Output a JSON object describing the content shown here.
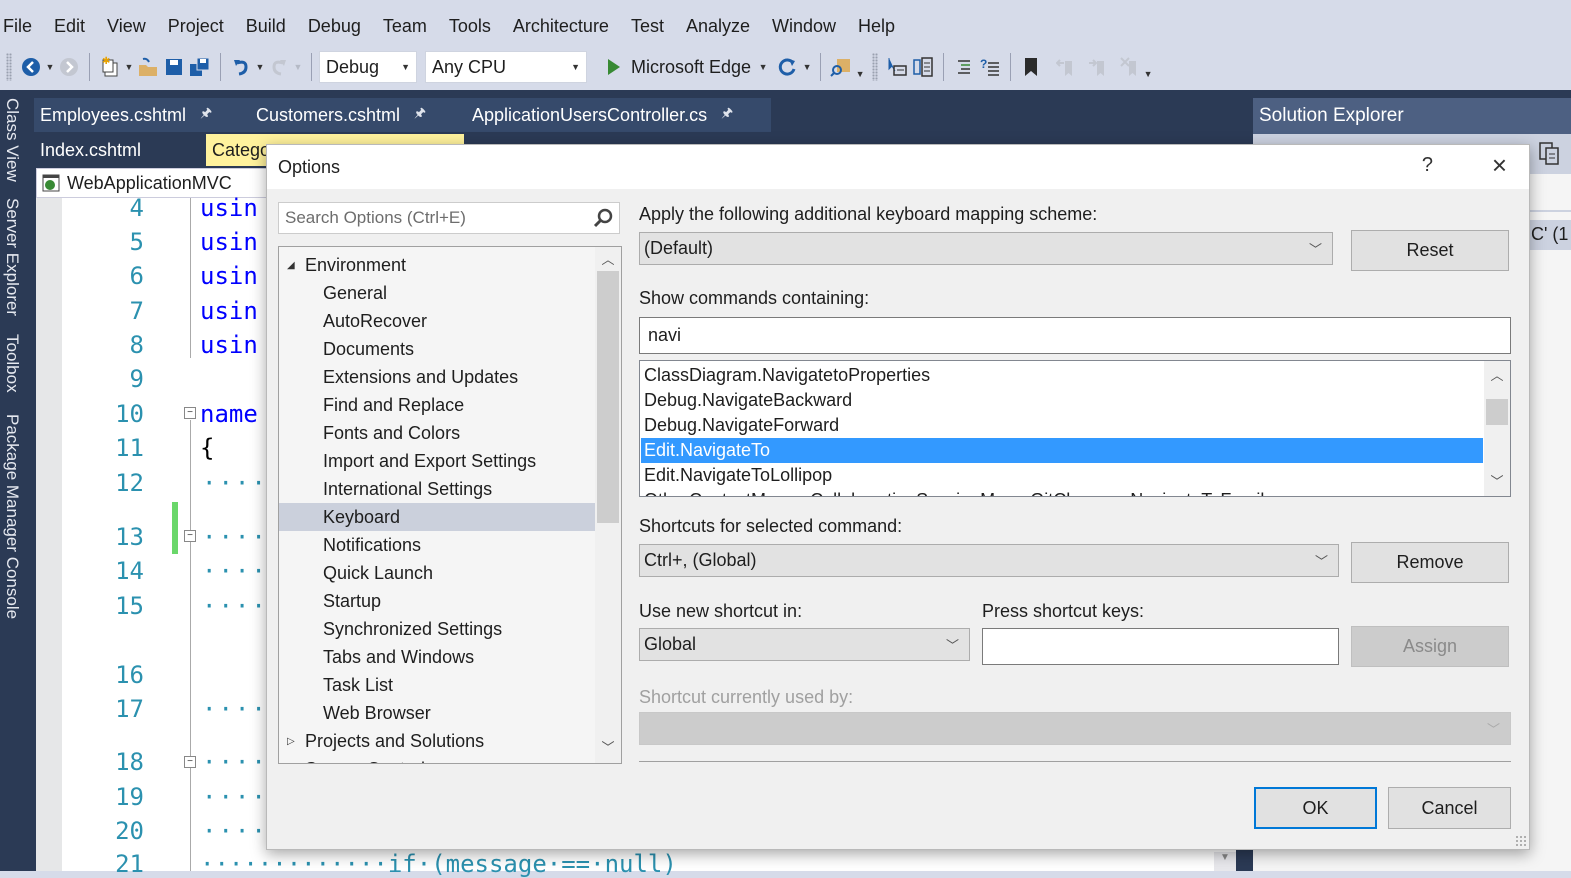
{
  "menu": [
    "File",
    "Edit",
    "View",
    "Project",
    "Build",
    "Debug",
    "Team",
    "Tools",
    "Architecture",
    "Test",
    "Analyze",
    "Window",
    "Help"
  ],
  "toolbar": {
    "configuration": "Debug",
    "platform": "Any CPU",
    "run_target": "Microsoft Edge",
    "icons": [
      "back-icon",
      "forward-icon",
      "new-project-icon",
      "open-folder-icon",
      "save-icon",
      "save-all-icon",
      "undo-icon",
      "redo-icon",
      "start-icon",
      "refresh-icon",
      "find-in-files-icon",
      "step-icon",
      "comment-icon",
      "indent-icon",
      "bookmark-icon",
      "prev-bookmark-icon",
      "next-bookmark-icon",
      "clear-bookmarks-icon"
    ]
  },
  "side_tabs": [
    "Class View",
    "Server Explorer",
    "Toolbox",
    "Package Manager Console"
  ],
  "doc_tabs": {
    "pinned": [
      "Employees.cshtml",
      "Customers.cshtml",
      "ApplicationUsersController.cs"
    ],
    "row2": [
      "Index.cshtml",
      "Catego"
    ]
  },
  "editor": {
    "project_dropdown": "WebApplicationMVC",
    "lines": [
      {
        "n": "4",
        "code": "usin"
      },
      {
        "n": "5",
        "code": "usin"
      },
      {
        "n": "6",
        "code": "usin"
      },
      {
        "n": "7",
        "code": "usin"
      },
      {
        "n": "8",
        "code": "usin"
      },
      {
        "n": "9",
        "code": ""
      },
      {
        "n": "10",
        "code": "name"
      },
      {
        "n": "11",
        "code": "{"
      },
      {
        "n": "12",
        "code": "····"
      },
      {
        "n": "13",
        "code": "····"
      },
      {
        "n": "14",
        "code": "····"
      },
      {
        "n": "15",
        "code": "····"
      },
      {
        "n": "16",
        "code": ""
      },
      {
        "n": "17",
        "code": "····"
      },
      {
        "n": "18",
        "code": "····"
      },
      {
        "n": "19",
        "code": "····"
      },
      {
        "n": "20",
        "code": "····"
      },
      {
        "n": "21",
        "code": "·············if·(message·==·null)"
      }
    ]
  },
  "solution_explorer": {
    "title": "Solution Explorer",
    "partial_text": "C' (1"
  },
  "dialog": {
    "title": "Options",
    "help": "?",
    "close": "×",
    "search_placeholder": "Search Options (Ctrl+E)",
    "tree": [
      {
        "label": "Environment",
        "level": 0,
        "expanded": true
      },
      {
        "label": "General",
        "level": 1
      },
      {
        "label": "AutoRecover",
        "level": 1
      },
      {
        "label": "Documents",
        "level": 1
      },
      {
        "label": "Extensions and Updates",
        "level": 1
      },
      {
        "label": "Find and Replace",
        "level": 1
      },
      {
        "label": "Fonts and Colors",
        "level": 1
      },
      {
        "label": "Import and Export Settings",
        "level": 1
      },
      {
        "label": "International Settings",
        "level": 1
      },
      {
        "label": "Keyboard",
        "level": 1,
        "selected": true
      },
      {
        "label": "Notifications",
        "level": 1
      },
      {
        "label": "Quick Launch",
        "level": 1
      },
      {
        "label": "Startup",
        "level": 1
      },
      {
        "label": "Synchronized Settings",
        "level": 1
      },
      {
        "label": "Tabs and Windows",
        "level": 1
      },
      {
        "label": "Task List",
        "level": 1
      },
      {
        "label": "Web Browser",
        "level": 1
      },
      {
        "label": "Projects and Solutions",
        "level": 0,
        "expanded": false
      },
      {
        "label": "Source Control",
        "level": 0,
        "expanded": false
      }
    ],
    "mapping_label": "Apply the following additional keyboard mapping scheme:",
    "mapping_value": "(Default)",
    "reset": "Reset",
    "show_commands_label": "Show commands containing:",
    "show_commands_value": "navi",
    "commands": [
      "ClassDiagram.NavigatetoProperties",
      "Debug.NavigateBackward",
      "Debug.NavigateForward",
      "Edit.NavigateTo",
      "Edit.NavigateToLollipop",
      "OtherContextMenus.CollaborationSessionMenu.GitChanges.NavigateToFamily"
    ],
    "selected_command": "Edit.NavigateTo",
    "shortcuts_label": "Shortcuts for selected command:",
    "shortcuts_value": "Ctrl+, (Global)",
    "remove": "Remove",
    "use_in_label": "Use new shortcut in:",
    "use_in_value": "Global",
    "press_keys_label": "Press shortcut keys:",
    "press_keys_value": "",
    "assign": "Assign",
    "used_by_label": "Shortcut currently used by:",
    "used_by_value": "",
    "ok": "OK",
    "cancel": "Cancel"
  },
  "colors": {
    "ide_dark": "#2b3a55",
    "selection_blue": "#3399ff",
    "tree_selected": "#cbd0dc",
    "line_number": "#2b91af",
    "keyword": "#0000ff",
    "active_tab": "#fff29d",
    "change_bar": "#6ad76a"
  }
}
